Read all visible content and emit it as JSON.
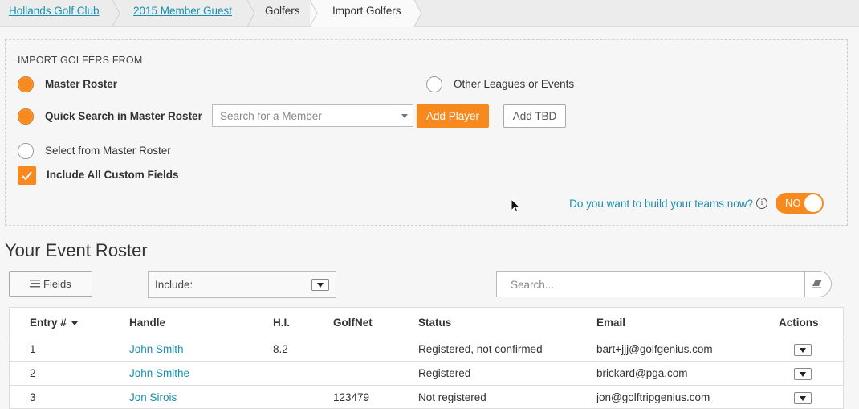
{
  "breadcrumb": {
    "items": [
      {
        "label": "Hollands Golf Club"
      },
      {
        "label": "2015 Member Guest"
      },
      {
        "label": "Golfers"
      },
      {
        "label": "Import Golfers"
      }
    ]
  },
  "import_panel": {
    "title": "IMPORT GOLFERS FROM",
    "options": {
      "master_roster": "Master Roster",
      "other_leagues": "Other Leagues or Events",
      "quick_search": "Quick Search in Master Roster",
      "select_from": "Select from Master Roster"
    },
    "member_search_placeholder": "Search for a Member",
    "add_player_label": "Add Player",
    "add_tbd_label": "Add TBD",
    "include_custom_fields_label": "Include All Custom Fields",
    "include_custom_fields_checked": true,
    "build_teams_question": "Do you want to build your teams now?",
    "build_teams_toggle": "NO",
    "accent_color": "#f7891e",
    "link_color": "#1a8fae"
  },
  "roster": {
    "title": "Your Event Roster",
    "fields_button": "Fields",
    "include_label": "Include:",
    "search_placeholder": "Search...",
    "columns": [
      "Entry #",
      "Handle",
      "H.I.",
      "GolfNet",
      "Status",
      "Email",
      "Actions"
    ],
    "rows": [
      {
        "entry": "1",
        "handle": "John Smith",
        "hi": "8.2",
        "golfnet": "",
        "status": "Registered, not confirmed",
        "email": "bart+jjj@golfgenius.com"
      },
      {
        "entry": "2",
        "handle": "John Smithe",
        "hi": "",
        "golfnet": "",
        "status": "Registered",
        "email": "brickard@pga.com"
      },
      {
        "entry": "3",
        "handle": "Jon Sirois",
        "hi": "",
        "golfnet": "123479",
        "status": "Not registered",
        "email": "jon@golftripgenius.com"
      }
    ]
  }
}
